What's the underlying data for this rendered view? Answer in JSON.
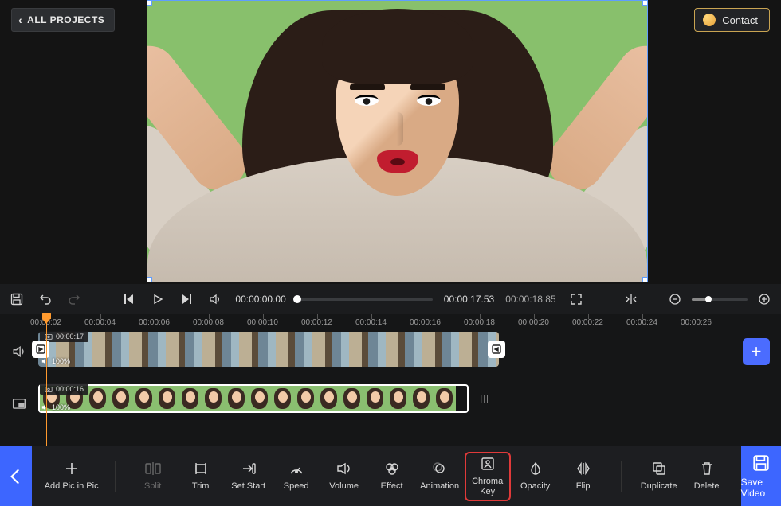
{
  "header": {
    "all_projects": "ALL PROJECTS",
    "contact": "Contact"
  },
  "player": {
    "current_time": "00:00:00.00",
    "elapsed": "00:00:17.53",
    "total": "00:00:18.85"
  },
  "ruler": {
    "ticks": [
      "00:00:02",
      "00:00:04",
      "00:00:06",
      "00:00:08",
      "00:00:10",
      "00:00:12",
      "00:00:14",
      "00:00:16",
      "00:00:18",
      "00:00:20",
      "00:00:22",
      "00:00:24",
      "00:00:26"
    ]
  },
  "tracks": {
    "clip1": {
      "duration_label": "00:00:17",
      "volume": "100%"
    },
    "clip2": {
      "duration_label": "00:00:16",
      "volume": "100%"
    }
  },
  "toolbar": {
    "add_pic": "Add Pic in Pic",
    "split": "Split",
    "trim": "Trim",
    "set_start": "Set Start",
    "speed": "Speed",
    "volume": "Volume",
    "effect": "Effect",
    "animation": "Animation",
    "chroma_key": "Chroma Key",
    "opacity": "Opacity",
    "flip": "Flip",
    "duplicate": "Duplicate",
    "delete": "Delete",
    "save_video": "Save Video"
  }
}
